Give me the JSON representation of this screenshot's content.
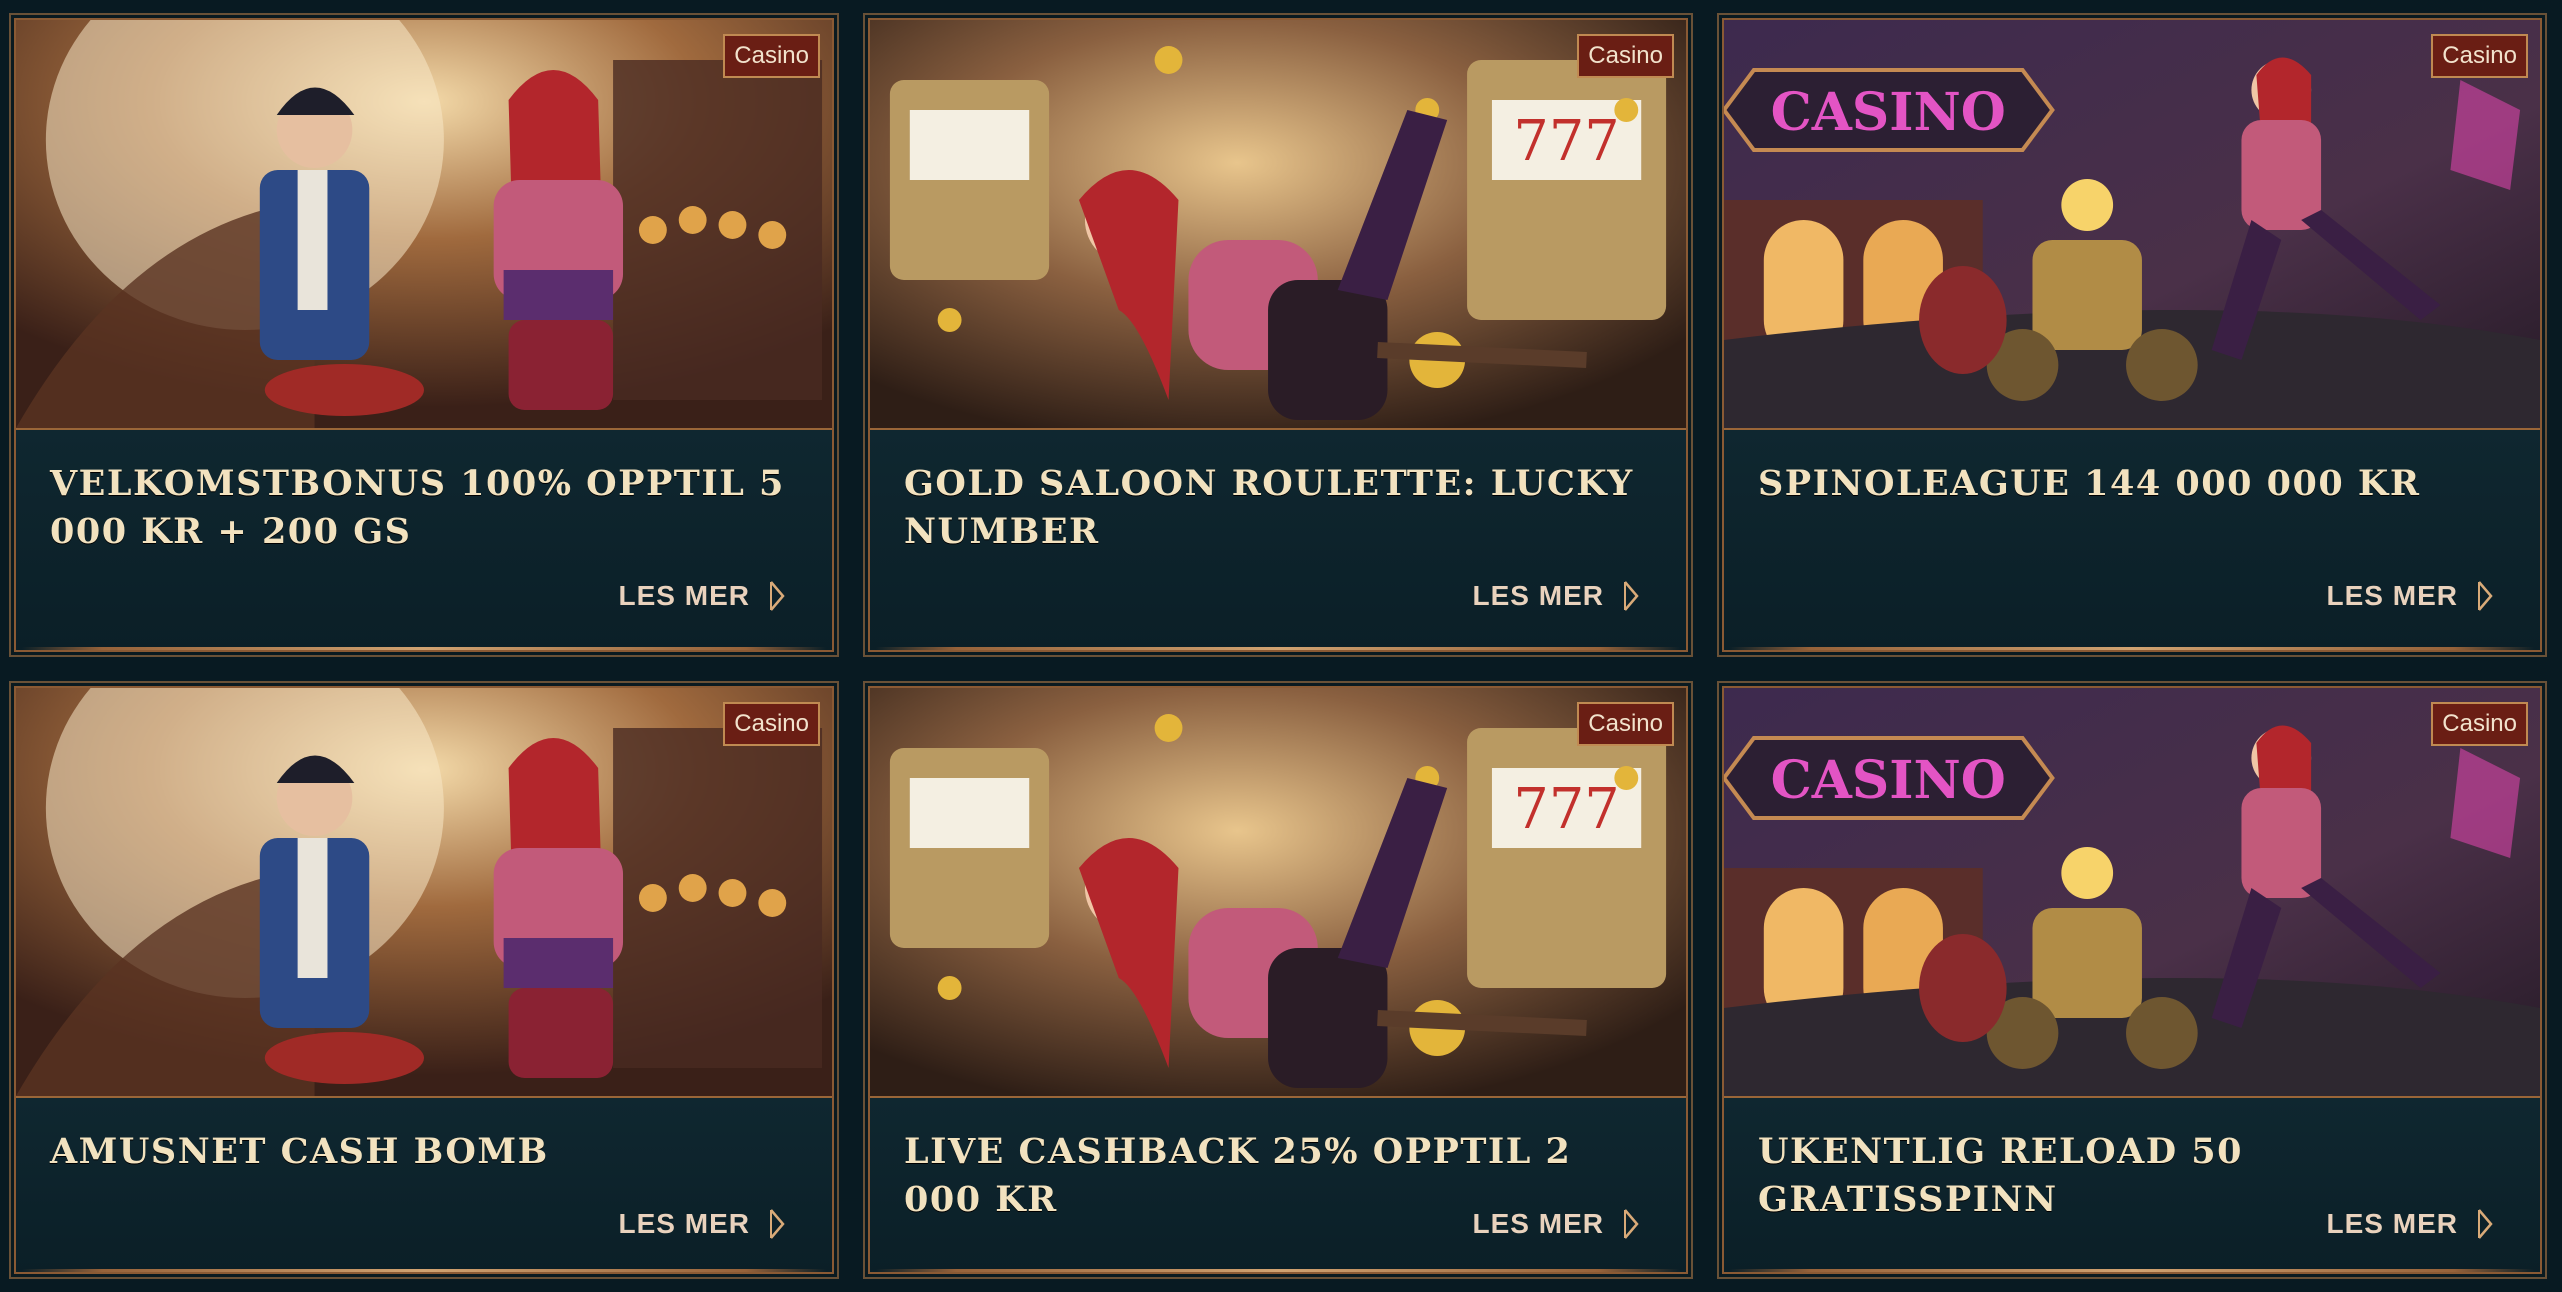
{
  "badge_label": "Casino",
  "read_more_label": "LES MER",
  "cards": [
    {
      "title": "VELKOMSTBONUS 100% OPPTIL 5 000 KR + 200 GS",
      "scene": "duo-lounge"
    },
    {
      "title": "GOLD SALOON ROULETTE: LUCKY NUMBER",
      "scene": "slots-girl"
    },
    {
      "title": "SPINOLEAGUE 144 000 000 KR",
      "scene": "casino-street"
    },
    {
      "title": "AMUSNET CASH BOMB",
      "scene": "duo-lounge"
    },
    {
      "title": "LIVE CASHBACK 25% OPPTIL 2 000 KR",
      "scene": "slots-girl"
    },
    {
      "title": "UKENTLIG RELOAD 50 GRATISSPINN",
      "scene": "casino-street"
    }
  ],
  "sign_text": "CASINO",
  "icons": {
    "read_more": "chevron-right-icon"
  },
  "colors": {
    "background": "#081a22",
    "card_body": "#0c232c",
    "title": "#f2e2bf",
    "badge_bg": "#6a1e14",
    "frame": "#c08a52"
  }
}
